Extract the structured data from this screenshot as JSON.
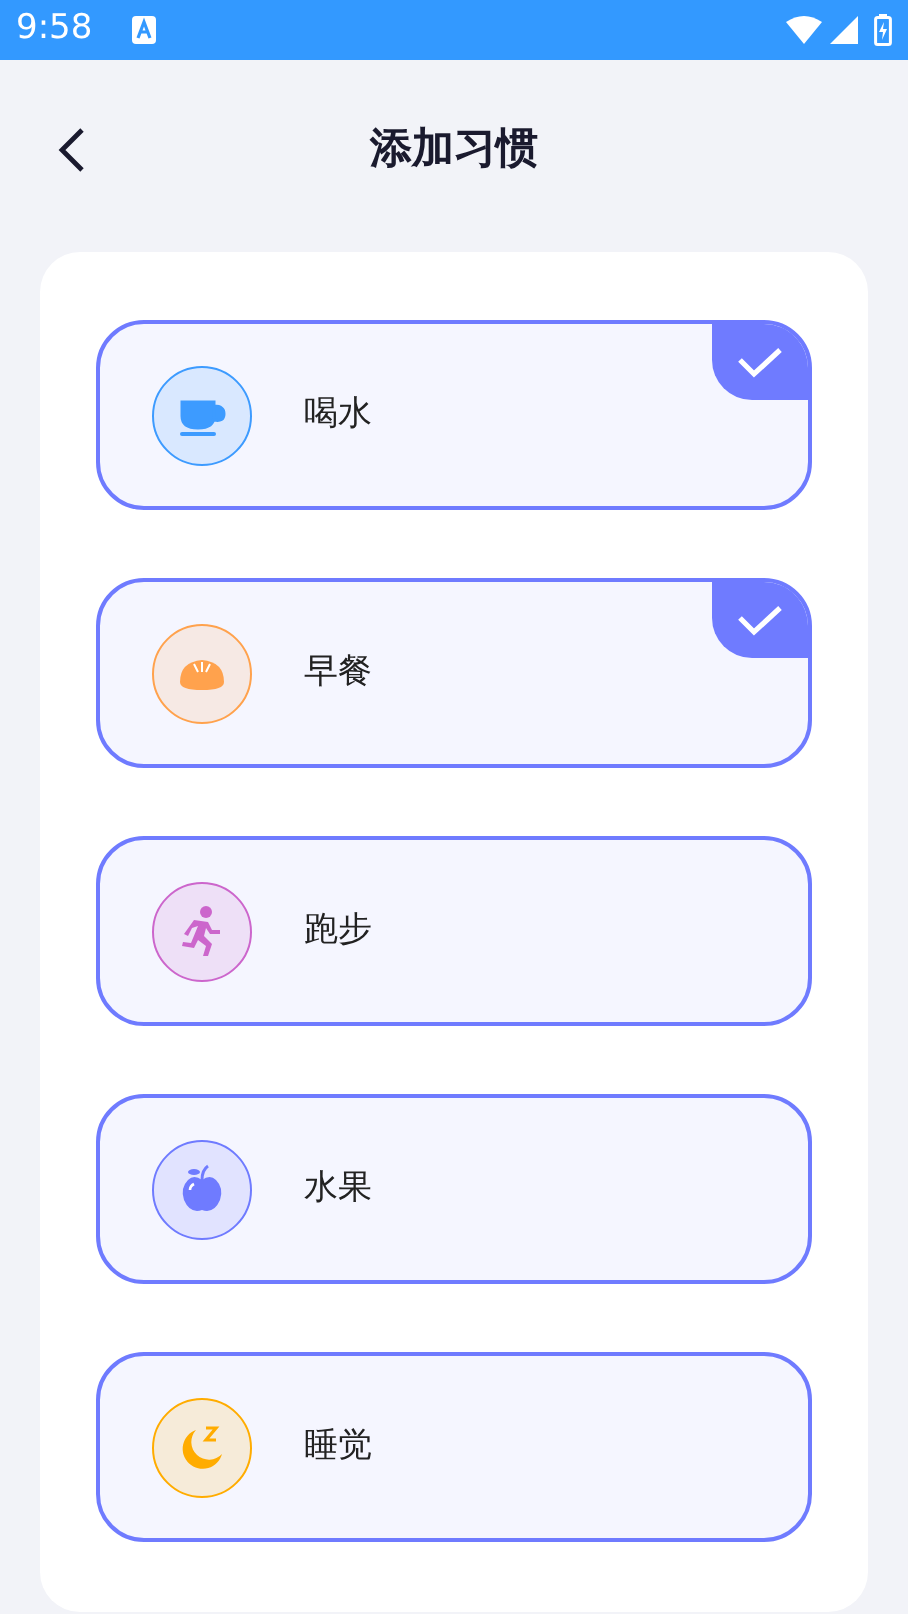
{
  "status_bar": {
    "time": "9:58"
  },
  "header": {
    "title": "添加习惯"
  },
  "habits": [
    {
      "label": "喝水",
      "checked": true,
      "color": "#3d9bff"
    },
    {
      "label": "早餐",
      "checked": true,
      "color": "#ffa24d"
    },
    {
      "label": "跑步",
      "checked": false,
      "color": "#cc66cc"
    },
    {
      "label": "水果",
      "checked": false,
      "color": "#6f7bff"
    },
    {
      "label": "睡觉",
      "checked": false,
      "color": "#ffac00"
    }
  ]
}
